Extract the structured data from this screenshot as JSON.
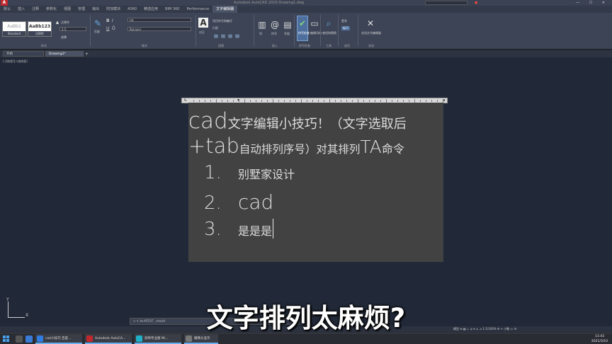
{
  "titlebar": {
    "logo": "A",
    "title": "Autodesk AutoCAD 2016   Drawing1.dwg",
    "window_controls": "— ☐ ✕"
  },
  "ribbon_tabs": [
    "默认",
    "插入",
    "注释",
    "参数化",
    "视图",
    "管理",
    "输出",
    "附加模块",
    "A360",
    "精选应用",
    "BIM 360",
    "Performance",
    "文字编辑器"
  ],
  "ribbon": {
    "style_panel": {
      "title": "样式",
      "style1_sample": "AaBb1",
      "style1_name": "Standard",
      "style2_sample": "AaBb123",
      "style2_name": "注释性",
      "annotative_label": "注释性",
      "height_value": "2.5",
      "mask_label": "遮罩"
    },
    "format_panel": {
      "title": "格式",
      "font_value": "txt",
      "color_value": "ByLayer",
      "bold": "B",
      "italic": "I",
      "underline": "U",
      "overline": "Ō",
      "match": "匹配"
    },
    "paragraph_panel": {
      "title": "段落",
      "justify_label": "对正",
      "list_label": "项目符号和编号",
      "line_spacing_label": "行距"
    },
    "insert_panel": {
      "title": "插入",
      "columns_label": "列",
      "symbol_label": "符号",
      "field_label": "字段"
    },
    "spell_panel": {
      "title": "拼写检查",
      "spell_label": "拼写检查",
      "dict_label": "编辑词典"
    },
    "tools_panel": {
      "title": "工具",
      "find_label": "查找和替换"
    },
    "options_panel": {
      "title": "选项",
      "more_label": "更多",
      "ruler_label": "标尺"
    },
    "close_panel": {
      "title": "关闭",
      "close_label": "关闭文字编辑器"
    }
  },
  "file_tabs": {
    "start": "开始",
    "drawing": "Drawing1*",
    "add": "+"
  },
  "viewport_label": "[-][俯视][二维线框]",
  "editor": {
    "line1_latin": "cad",
    "line1_cjk": "文字编辑小技巧！（文字选取后",
    "line2_latin1": "+tab",
    "line2_cjk1": "自动排列序号）对其排列",
    "line2_latin2": "TA",
    "line2_cjk2": "命令",
    "items": [
      {
        "num": "1.",
        "text": "别墅家设计"
      },
      {
        "num": "2.",
        "text": "cad"
      },
      {
        "num": "3.",
        "text": "是是是"
      }
    ]
  },
  "ucs": {
    "y": "Y",
    "x": "X"
  },
  "command_line": "× ✎  A▾  MTEXT _mtedit",
  "status_bar": "模型  ⊞ ▦ ∟ ◎ ⌖ ∠ ⊿  1:1/100%  ⚙  + 小数  ▭ ☰",
  "subtitle": "文字排列太麻烦?",
  "taskbar": {
    "tasks": [
      {
        "label": "cad小技巧 百度..."
      },
      {
        "label": "Autodesk AutoCA..."
      },
      {
        "label": "剪映专业版 Mi..."
      },
      {
        "label": "摄像头显示"
      }
    ],
    "time": "11:43",
    "date": "2021/3/10"
  },
  "colors": {
    "canvas": "#212837",
    "editor_bg": "#424242",
    "ribbon": "#3c4456",
    "accent_active": "#4e6f9e",
    "logo_red": "#c0282d"
  }
}
